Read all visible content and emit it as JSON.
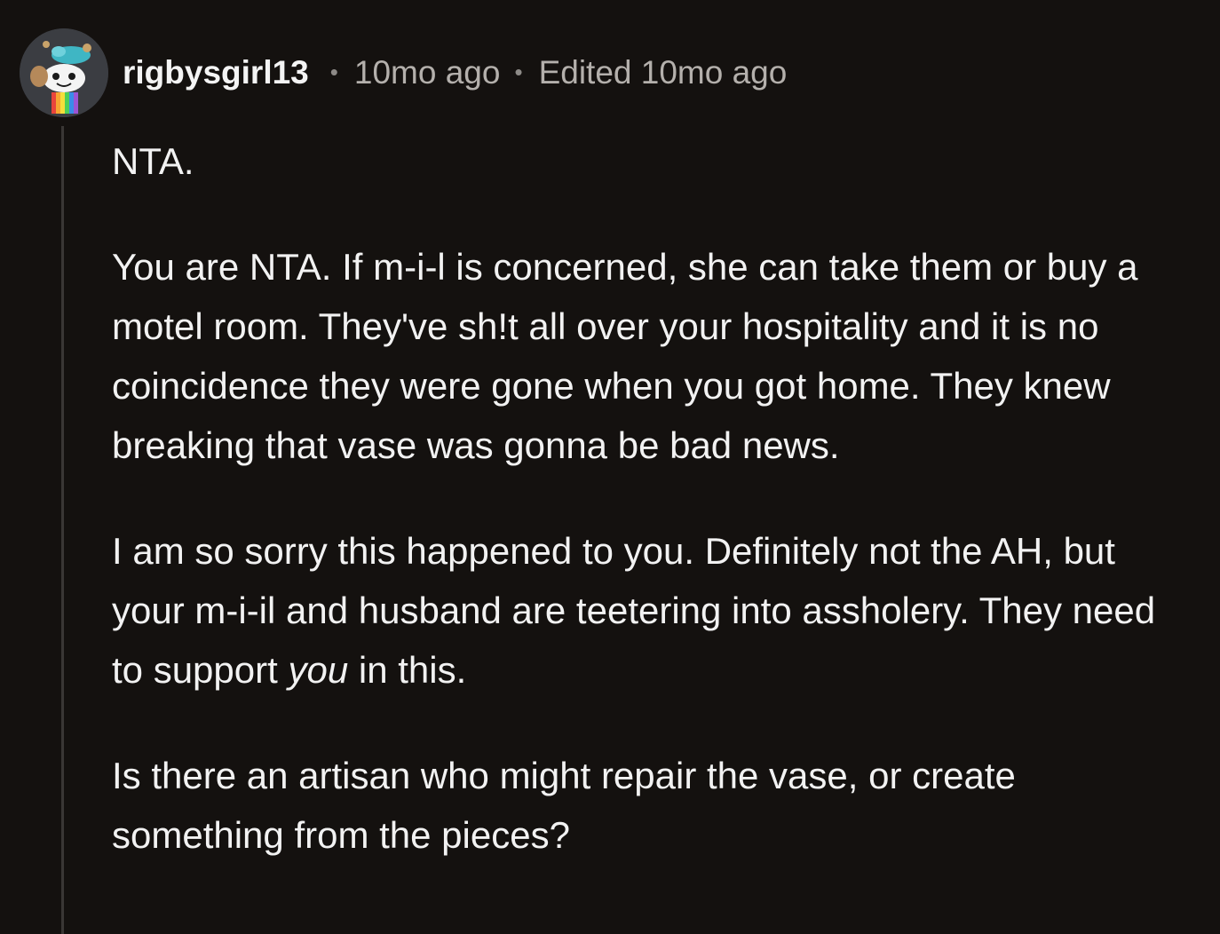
{
  "comment": {
    "author": "rigbysgirl13",
    "separator": "•",
    "time": "10mo ago",
    "edited": "Edited 10mo ago",
    "paragraphs": {
      "p1": "NTA.",
      "p2": "You are NTA. If m-i-l is concerned, she can take them or buy a motel room. They've sh!t all over your hospitality and it is no coincidence they were gone when you got home. They knew breaking that vase was gonna be bad news.",
      "p3_before": "I am so sorry this happened to you. Definitely not the AH, but your m-i-il and husband are teetering into assholery. They need to support ",
      "p3_emphasis": "you",
      "p3_after": " in this.",
      "p4": "Is there an artisan who might repair the vase, or create something from the pieces?"
    },
    "avatar_icon": "snoo-avatar-icon",
    "colors": {
      "background": "#14110f",
      "text": "#f2f2f2",
      "meta": "#b4b0ac",
      "thread_line": "#3a3735"
    }
  }
}
